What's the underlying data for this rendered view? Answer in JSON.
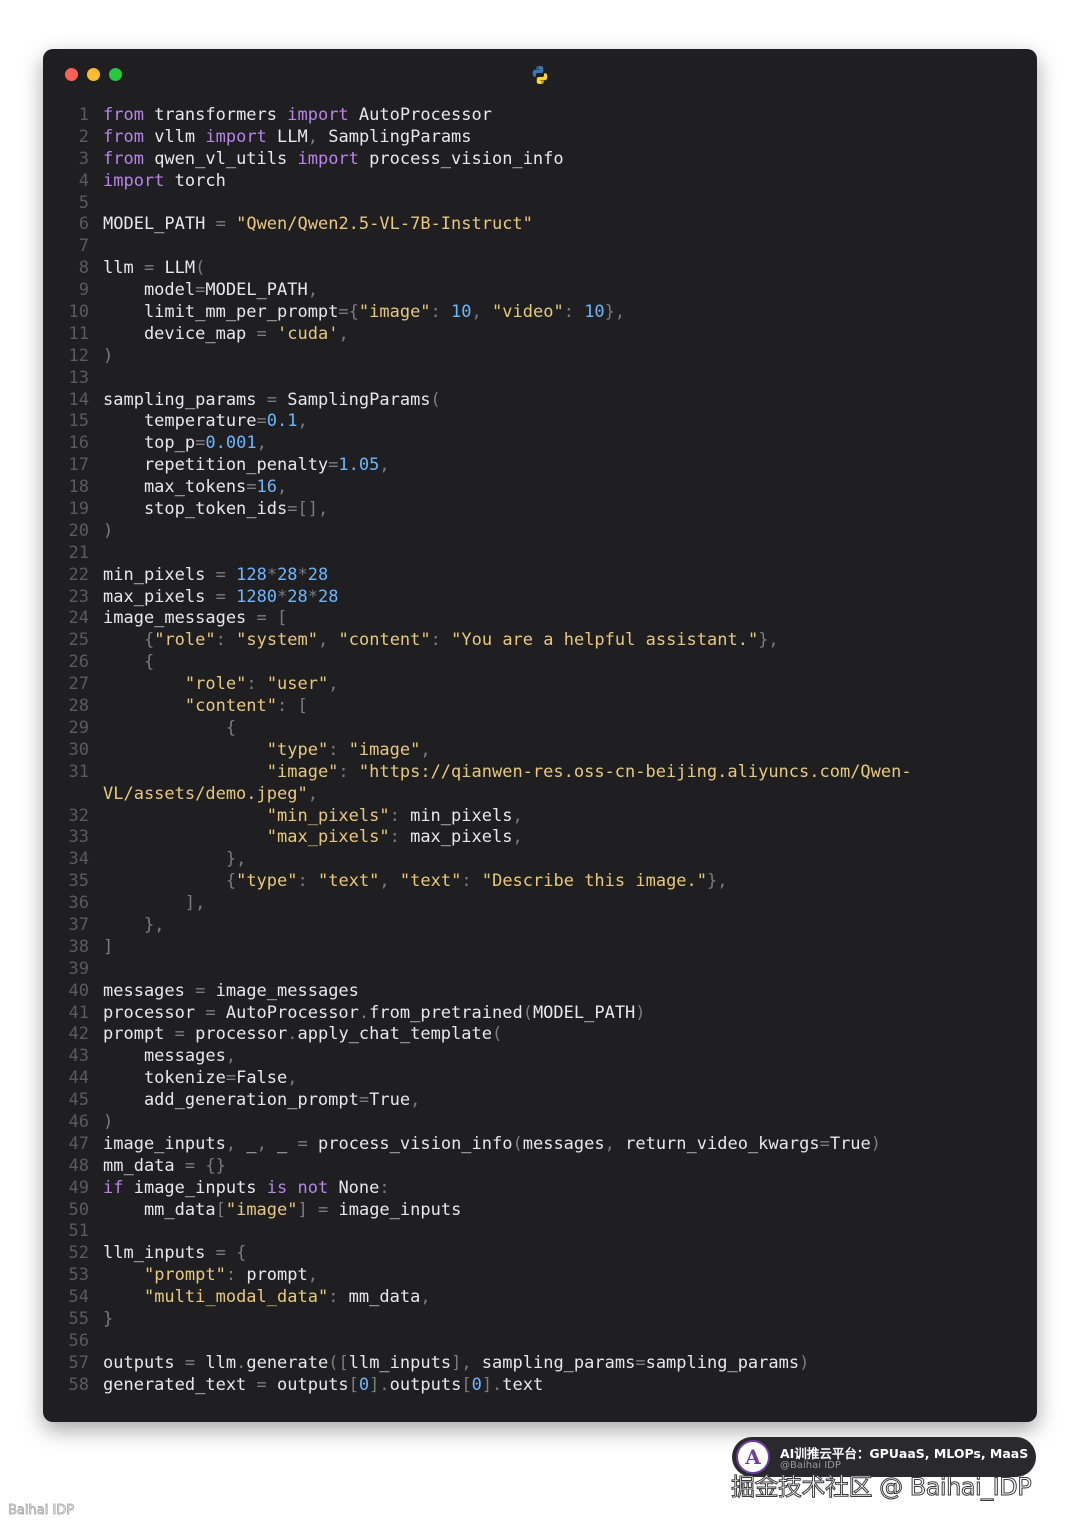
{
  "window": {
    "controls": [
      "close",
      "minimize",
      "zoom"
    ],
    "language_icon": "python-logo-icon"
  },
  "colors": {
    "background": "#1f1f22",
    "keyword": "#b884e6",
    "string": "#e8c87a",
    "number": "#6cb6ff",
    "punctuation": "#7b7b82",
    "text": "#e8e8e8",
    "line_number": "#5a5a60"
  },
  "code": [
    {
      "n": "1",
      "t": [
        [
          "kw",
          "from"
        ],
        [
          "id",
          " transformers "
        ],
        [
          "kw",
          "import"
        ],
        [
          "id",
          " AutoProcessor"
        ]
      ]
    },
    {
      "n": "2",
      "t": [
        [
          "kw",
          "from"
        ],
        [
          "id",
          " vllm "
        ],
        [
          "kw",
          "import"
        ],
        [
          "id",
          " LLM"
        ],
        [
          "pun",
          ","
        ],
        [
          "id",
          " SamplingParams"
        ]
      ]
    },
    {
      "n": "3",
      "t": [
        [
          "kw",
          "from"
        ],
        [
          "id",
          " qwen_vl_utils "
        ],
        [
          "kw",
          "import"
        ],
        [
          "id",
          " process_vision_info"
        ]
      ]
    },
    {
      "n": "4",
      "t": [
        [
          "kw",
          "import"
        ],
        [
          "id",
          " torch"
        ]
      ]
    },
    {
      "n": "5",
      "t": []
    },
    {
      "n": "6",
      "t": [
        [
          "id",
          "MODEL_PATH "
        ],
        [
          "pun",
          "="
        ],
        [
          "id",
          " "
        ],
        [
          "str",
          "\"Qwen/Qwen2.5-VL-7B-Instruct\""
        ]
      ]
    },
    {
      "n": "7",
      "t": []
    },
    {
      "n": "8",
      "t": [
        [
          "id",
          "llm "
        ],
        [
          "pun",
          "="
        ],
        [
          "id",
          " LLM"
        ],
        [
          "pun",
          "("
        ]
      ]
    },
    {
      "n": "9",
      "t": [
        [
          "id",
          "    model"
        ],
        [
          "pun",
          "="
        ],
        [
          "id",
          "MODEL_PATH"
        ],
        [
          "pun",
          ","
        ]
      ]
    },
    {
      "n": "10",
      "t": [
        [
          "id",
          "    limit_mm_per_prompt"
        ],
        [
          "pun",
          "={"
        ],
        [
          "str",
          "\"image\""
        ],
        [
          "pun",
          ":"
        ],
        [
          "id",
          " "
        ],
        [
          "num",
          "10"
        ],
        [
          "pun",
          ","
        ],
        [
          "id",
          " "
        ],
        [
          "str",
          "\"video\""
        ],
        [
          "pun",
          ":"
        ],
        [
          "id",
          " "
        ],
        [
          "num",
          "10"
        ],
        [
          "pun",
          "},"
        ]
      ]
    },
    {
      "n": "11",
      "t": [
        [
          "id",
          "    device_map "
        ],
        [
          "pun",
          "="
        ],
        [
          "id",
          " "
        ],
        [
          "str",
          "'cuda'"
        ],
        [
          "pun",
          ","
        ]
      ]
    },
    {
      "n": "12",
      "t": [
        [
          "pun",
          ")"
        ]
      ]
    },
    {
      "n": "13",
      "t": []
    },
    {
      "n": "14",
      "t": [
        [
          "id",
          "sampling_params "
        ],
        [
          "pun",
          "="
        ],
        [
          "id",
          " SamplingParams"
        ],
        [
          "pun",
          "("
        ]
      ]
    },
    {
      "n": "15",
      "t": [
        [
          "id",
          "    temperature"
        ],
        [
          "pun",
          "="
        ],
        [
          "num",
          "0.1"
        ],
        [
          "pun",
          ","
        ]
      ]
    },
    {
      "n": "16",
      "t": [
        [
          "id",
          "    top_p"
        ],
        [
          "pun",
          "="
        ],
        [
          "num",
          "0.001"
        ],
        [
          "pun",
          ","
        ]
      ]
    },
    {
      "n": "17",
      "t": [
        [
          "id",
          "    repetition_penalty"
        ],
        [
          "pun",
          "="
        ],
        [
          "num",
          "1.05"
        ],
        [
          "pun",
          ","
        ]
      ]
    },
    {
      "n": "18",
      "t": [
        [
          "id",
          "    max_tokens"
        ],
        [
          "pun",
          "="
        ],
        [
          "num",
          "16"
        ],
        [
          "pun",
          ","
        ]
      ]
    },
    {
      "n": "19",
      "t": [
        [
          "id",
          "    stop_token_ids"
        ],
        [
          "pun",
          "=[],"
        ]
      ]
    },
    {
      "n": "20",
      "t": [
        [
          "pun",
          ")"
        ]
      ]
    },
    {
      "n": "21",
      "t": []
    },
    {
      "n": "22",
      "t": [
        [
          "id",
          "min_pixels "
        ],
        [
          "pun",
          "="
        ],
        [
          "id",
          " "
        ],
        [
          "num",
          "128"
        ],
        [
          "pun",
          "*"
        ],
        [
          "num",
          "28"
        ],
        [
          "pun",
          "*"
        ],
        [
          "num",
          "28"
        ]
      ]
    },
    {
      "n": "23",
      "t": [
        [
          "id",
          "max_pixels "
        ],
        [
          "pun",
          "="
        ],
        [
          "id",
          " "
        ],
        [
          "num",
          "1280"
        ],
        [
          "pun",
          "*"
        ],
        [
          "num",
          "28"
        ],
        [
          "pun",
          "*"
        ],
        [
          "num",
          "28"
        ]
      ]
    },
    {
      "n": "24",
      "t": [
        [
          "id",
          "image_messages "
        ],
        [
          "pun",
          "="
        ],
        [
          "id",
          " "
        ],
        [
          "pun",
          "["
        ]
      ]
    },
    {
      "n": "25",
      "t": [
        [
          "id",
          "    "
        ],
        [
          "pun",
          "{"
        ],
        [
          "str",
          "\"role\""
        ],
        [
          "pun",
          ":"
        ],
        [
          "id",
          " "
        ],
        [
          "str",
          "\"system\""
        ],
        [
          "pun",
          ","
        ],
        [
          "id",
          " "
        ],
        [
          "str",
          "\"content\""
        ],
        [
          "pun",
          ":"
        ],
        [
          "id",
          " "
        ],
        [
          "str",
          "\"You are a helpful assistant.\""
        ],
        [
          "pun",
          "},"
        ]
      ]
    },
    {
      "n": "26",
      "t": [
        [
          "id",
          "    "
        ],
        [
          "pun",
          "{"
        ]
      ]
    },
    {
      "n": "27",
      "t": [
        [
          "id",
          "        "
        ],
        [
          "str",
          "\"role\""
        ],
        [
          "pun",
          ":"
        ],
        [
          "id",
          " "
        ],
        [
          "str",
          "\"user\""
        ],
        [
          "pun",
          ","
        ]
      ]
    },
    {
      "n": "28",
      "t": [
        [
          "id",
          "        "
        ],
        [
          "str",
          "\"content\""
        ],
        [
          "pun",
          ":"
        ],
        [
          "id",
          " "
        ],
        [
          "pun",
          "["
        ]
      ]
    },
    {
      "n": "29",
      "t": [
        [
          "id",
          "            "
        ],
        [
          "pun",
          "{"
        ]
      ]
    },
    {
      "n": "30",
      "t": [
        [
          "id",
          "                "
        ],
        [
          "str",
          "\"type\""
        ],
        [
          "pun",
          ":"
        ],
        [
          "id",
          " "
        ],
        [
          "str",
          "\"image\""
        ],
        [
          "pun",
          ","
        ]
      ]
    },
    {
      "n": "31",
      "t": [
        [
          "id",
          "                "
        ],
        [
          "str",
          "\"image\""
        ],
        [
          "pun",
          ":"
        ],
        [
          "id",
          " "
        ],
        [
          "str",
          "\"https://qianwen-res.oss-cn-beijing.aliyuncs.com/Qwen-"
        ]
      ]
    },
    {
      "n": "",
      "t": [
        [
          "str",
          "VL/assets/demo.jpeg\""
        ],
        [
          "pun",
          ","
        ]
      ]
    },
    {
      "n": "32",
      "t": [
        [
          "id",
          "                "
        ],
        [
          "str",
          "\"min_pixels\""
        ],
        [
          "pun",
          ":"
        ],
        [
          "id",
          " min_pixels"
        ],
        [
          "pun",
          ","
        ]
      ]
    },
    {
      "n": "33",
      "t": [
        [
          "id",
          "                "
        ],
        [
          "str",
          "\"max_pixels\""
        ],
        [
          "pun",
          ":"
        ],
        [
          "id",
          " max_pixels"
        ],
        [
          "pun",
          ","
        ]
      ]
    },
    {
      "n": "34",
      "t": [
        [
          "id",
          "            "
        ],
        [
          "pun",
          "},"
        ]
      ]
    },
    {
      "n": "35",
      "t": [
        [
          "id",
          "            "
        ],
        [
          "pun",
          "{"
        ],
        [
          "str",
          "\"type\""
        ],
        [
          "pun",
          ":"
        ],
        [
          "id",
          " "
        ],
        [
          "str",
          "\"text\""
        ],
        [
          "pun",
          ","
        ],
        [
          "id",
          " "
        ],
        [
          "str",
          "\"text\""
        ],
        [
          "pun",
          ":"
        ],
        [
          "id",
          " "
        ],
        [
          "str",
          "\"Describe this image.\""
        ],
        [
          "pun",
          "},"
        ]
      ]
    },
    {
      "n": "36",
      "t": [
        [
          "id",
          "        "
        ],
        [
          "pun",
          "],"
        ]
      ]
    },
    {
      "n": "37",
      "t": [
        [
          "id",
          "    "
        ],
        [
          "pun",
          "},"
        ]
      ]
    },
    {
      "n": "38",
      "t": [
        [
          "pun",
          "]"
        ]
      ]
    },
    {
      "n": "39",
      "t": []
    },
    {
      "n": "40",
      "t": [
        [
          "id",
          "messages "
        ],
        [
          "pun",
          "="
        ],
        [
          "id",
          " image_messages"
        ]
      ]
    },
    {
      "n": "41",
      "t": [
        [
          "id",
          "processor "
        ],
        [
          "pun",
          "="
        ],
        [
          "id",
          " AutoProcessor"
        ],
        [
          "pun",
          "."
        ],
        [
          "id",
          "from_pretrained"
        ],
        [
          "pun",
          "("
        ],
        [
          "id",
          "MODEL_PATH"
        ],
        [
          "pun",
          ")"
        ]
      ]
    },
    {
      "n": "42",
      "t": [
        [
          "id",
          "prompt "
        ],
        [
          "pun",
          "="
        ],
        [
          "id",
          " processor"
        ],
        [
          "pun",
          "."
        ],
        [
          "id",
          "apply_chat_template"
        ],
        [
          "pun",
          "("
        ]
      ]
    },
    {
      "n": "43",
      "t": [
        [
          "id",
          "    messages"
        ],
        [
          "pun",
          ","
        ]
      ]
    },
    {
      "n": "44",
      "t": [
        [
          "id",
          "    tokenize"
        ],
        [
          "pun",
          "="
        ],
        [
          "id",
          "False"
        ],
        [
          "pun",
          ","
        ]
      ]
    },
    {
      "n": "45",
      "t": [
        [
          "id",
          "    add_generation_prompt"
        ],
        [
          "pun",
          "="
        ],
        [
          "id",
          "True"
        ],
        [
          "pun",
          ","
        ]
      ]
    },
    {
      "n": "46",
      "t": [
        [
          "pun",
          ")"
        ]
      ]
    },
    {
      "n": "47",
      "t": [
        [
          "id",
          "image_inputs"
        ],
        [
          "pun",
          ","
        ],
        [
          "id",
          " _"
        ],
        [
          "pun",
          ","
        ],
        [
          "id",
          " _ "
        ],
        [
          "pun",
          "="
        ],
        [
          "id",
          " process_vision_info"
        ],
        [
          "pun",
          "("
        ],
        [
          "id",
          "messages"
        ],
        [
          "pun",
          ","
        ],
        [
          "id",
          " return_video_kwargs"
        ],
        [
          "pun",
          "="
        ],
        [
          "id",
          "True"
        ],
        [
          "pun",
          ")"
        ]
      ]
    },
    {
      "n": "48",
      "t": [
        [
          "id",
          "mm_data "
        ],
        [
          "pun",
          "="
        ],
        [
          "id",
          " "
        ],
        [
          "pun",
          "{}"
        ]
      ]
    },
    {
      "n": "49",
      "t": [
        [
          "kw",
          "if"
        ],
        [
          "id",
          " image_inputs "
        ],
        [
          "kw",
          "is not"
        ],
        [
          "id",
          " None"
        ],
        [
          "pun",
          ":"
        ]
      ]
    },
    {
      "n": "50",
      "t": [
        [
          "id",
          "    mm_data"
        ],
        [
          "pun",
          "["
        ],
        [
          "str",
          "\"image\""
        ],
        [
          "pun",
          "]"
        ],
        [
          "id",
          " "
        ],
        [
          "pun",
          "="
        ],
        [
          "id",
          " image_inputs"
        ]
      ]
    },
    {
      "n": "51",
      "t": []
    },
    {
      "n": "52",
      "t": [
        [
          "id",
          "llm_inputs "
        ],
        [
          "pun",
          "="
        ],
        [
          "id",
          " "
        ],
        [
          "pun",
          "{"
        ]
      ]
    },
    {
      "n": "53",
      "t": [
        [
          "id",
          "    "
        ],
        [
          "str",
          "\"prompt\""
        ],
        [
          "pun",
          ":"
        ],
        [
          "id",
          " prompt"
        ],
        [
          "pun",
          ","
        ]
      ]
    },
    {
      "n": "54",
      "t": [
        [
          "id",
          "    "
        ],
        [
          "str",
          "\"multi_modal_data\""
        ],
        [
          "pun",
          ":"
        ],
        [
          "id",
          " mm_data"
        ],
        [
          "pun",
          ","
        ]
      ]
    },
    {
      "n": "55",
      "t": [
        [
          "pun",
          "}"
        ]
      ]
    },
    {
      "n": "56",
      "t": []
    },
    {
      "n": "57",
      "t": [
        [
          "id",
          "outputs "
        ],
        [
          "pun",
          "="
        ],
        [
          "id",
          " llm"
        ],
        [
          "pun",
          "."
        ],
        [
          "id",
          "generate"
        ],
        [
          "pun",
          "(["
        ],
        [
          "id",
          "llm_inputs"
        ],
        [
          "pun",
          "],"
        ],
        [
          "id",
          " sampling_params"
        ],
        [
          "pun",
          "="
        ],
        [
          "id",
          "sampling_params"
        ],
        [
          "pun",
          ")"
        ]
      ]
    },
    {
      "n": "58",
      "t": [
        [
          "id",
          "generated_text "
        ],
        [
          "pun",
          "="
        ],
        [
          "id",
          " outputs"
        ],
        [
          "pun",
          "["
        ],
        [
          "num",
          "0"
        ],
        [
          "pun",
          "]."
        ],
        [
          "id",
          "outputs"
        ],
        [
          "pun",
          "["
        ],
        [
          "num",
          "0"
        ],
        [
          "pun",
          "]."
        ],
        [
          "id",
          "text"
        ]
      ]
    }
  ],
  "badge": {
    "logo_letter": "A",
    "title": "AI训推云平台：GPUaaS, MLOPs, MaaS",
    "subtitle": "@Baihai IDP"
  },
  "watermark": {
    "main": "掘金技术社区 @ Baihai_IDP",
    "corner": "Baihai IDP"
  }
}
